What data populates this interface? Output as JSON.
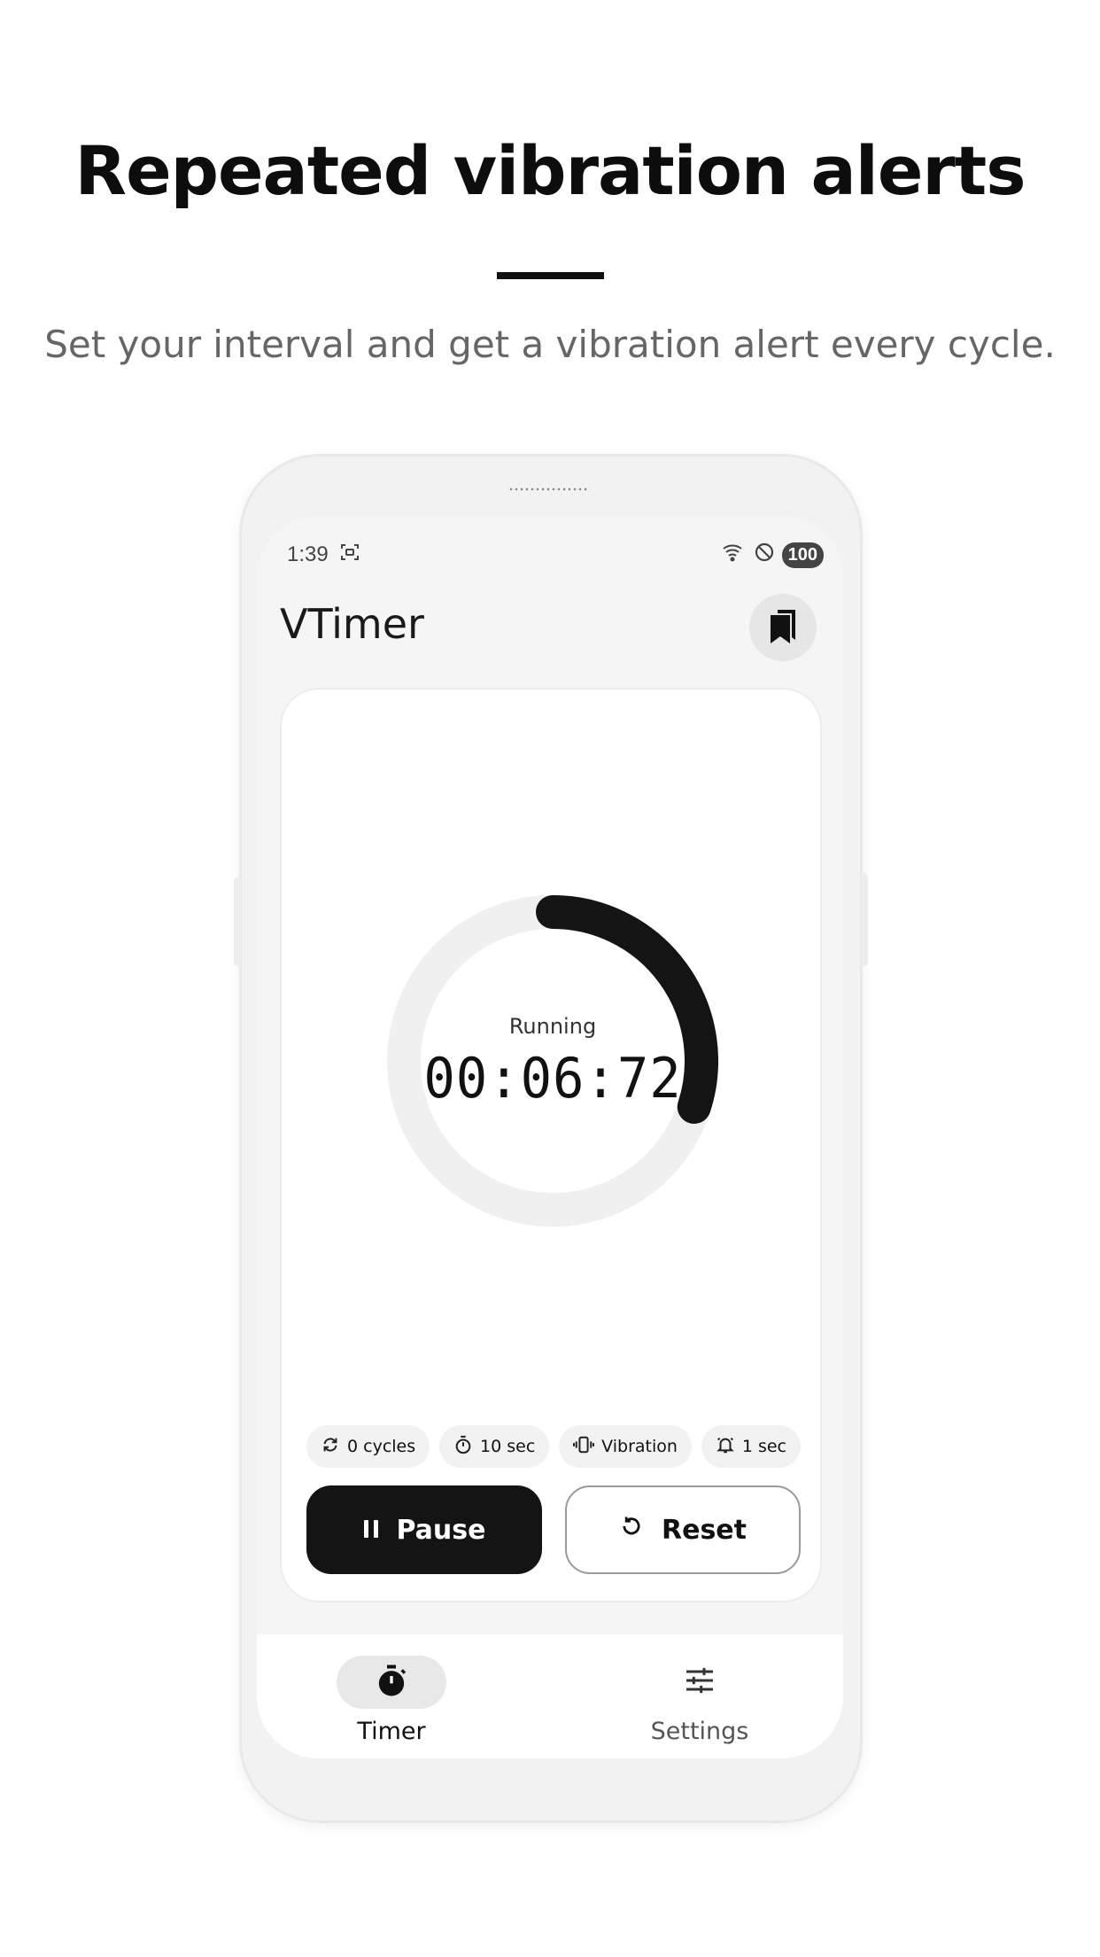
{
  "promo": {
    "headline": "Repeated vibration alerts",
    "subline": "Set your interval and get a vibration alert every cycle."
  },
  "status_bar": {
    "time": "1:39",
    "battery": "100"
  },
  "app": {
    "title": "VTimer"
  },
  "timer": {
    "state": "Running",
    "display": "00:06:72",
    "progress_fraction": 0.3
  },
  "chips": [
    {
      "label": "0 cycles",
      "icon": "repeat-icon"
    },
    {
      "label": "10 sec",
      "icon": "stopwatch-icon"
    },
    {
      "label": "Vibration",
      "icon": "vibration-icon"
    },
    {
      "label": "1 sec",
      "icon": "bell-icon"
    }
  ],
  "buttons": {
    "pause": "Pause",
    "reset": "Reset"
  },
  "nav": {
    "timer": "Timer",
    "settings": "Settings"
  },
  "colors": {
    "primary": "#141414",
    "track": "#f0f0f0",
    "background": "#ffffff"
  }
}
